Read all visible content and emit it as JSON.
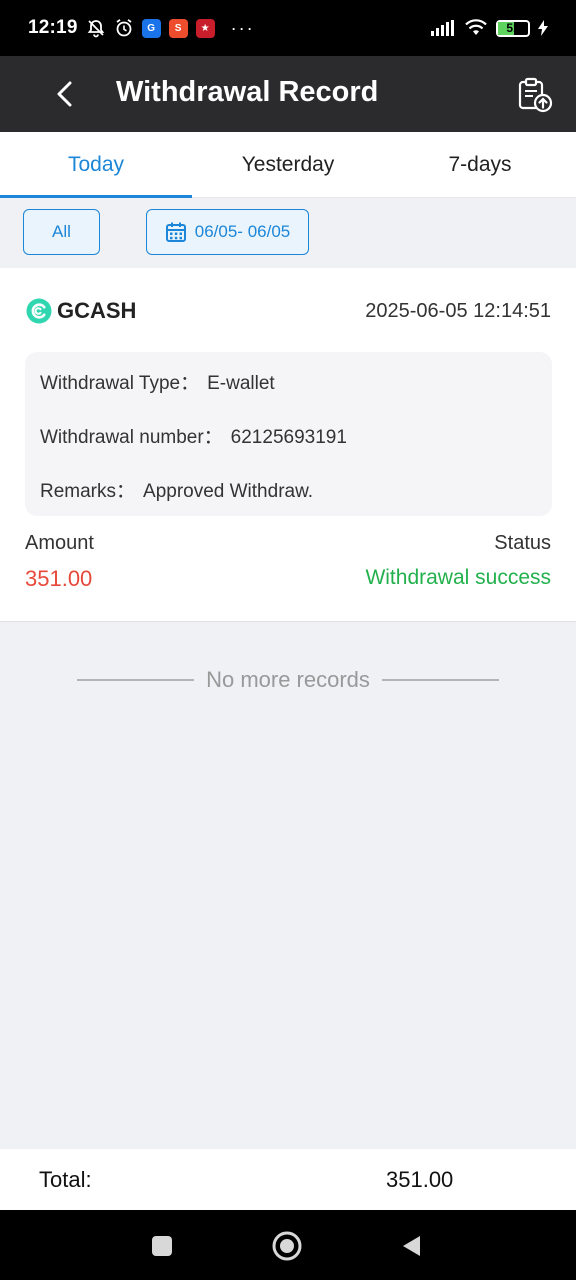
{
  "status_bar": {
    "time": "12:19",
    "icons": [
      "bell-off-icon",
      "alarm-icon",
      "app-g-icon",
      "app-shop-icon",
      "app-game-icon",
      "more-dots-icon",
      "signal-icon",
      "wifi-icon",
      "battery-icon",
      "charging-icon"
    ],
    "battery_level": "51",
    "dots": "···"
  },
  "header": {
    "title": "Withdrawal Record",
    "back_icon": "chevron-left-icon",
    "action_icon": "clipboard-upload-icon"
  },
  "tabs": [
    {
      "label": "Today",
      "active": true
    },
    {
      "label": "Yesterday",
      "active": false
    },
    {
      "label": "7-days",
      "active": false
    }
  ],
  "filters": {
    "all_label": "All",
    "date_range": "06/05- 06/05",
    "calendar_icon": "calendar-icon"
  },
  "record": {
    "provider": "GCASH",
    "provider_icon": "gcash-logo-icon",
    "time": "2025-06-05 12:14:51",
    "type_label": "Withdrawal Type：",
    "type_value": "E-wallet",
    "number_label": "Withdrawal number：",
    "number_value": "62125693191",
    "remarks_label": "Remarks：",
    "remarks_value": "Approved Withdraw.",
    "amount_label": "Amount",
    "amount_value": "351.00",
    "status_label": "Status",
    "status_value": "Withdrawal success"
  },
  "list_end": "No more records",
  "footer": {
    "total_label": "Total:",
    "total_value": "351.00"
  },
  "colors": {
    "accent": "#1c86d8",
    "amount": "#e74a3b",
    "success": "#22b14c",
    "header_bg": "#2b2b2d"
  }
}
